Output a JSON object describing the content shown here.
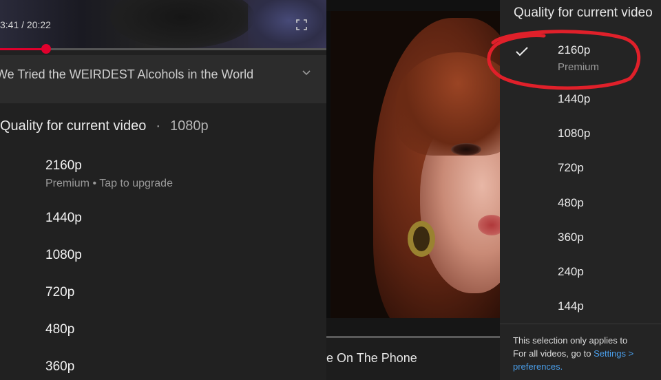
{
  "left_panel": {
    "timecode": "3:41 / 20:22",
    "progress_fraction": 0.15,
    "video_title": "We Tried the WEIRDEST Alcohols in the World",
    "quality_header": {
      "label": "Quality for current video",
      "separator": "·",
      "current": "1080p"
    },
    "options": [
      {
        "label": "2160p",
        "sub": "Premium • Tap to upgrade"
      },
      {
        "label": "1440p"
      },
      {
        "label": "1080p"
      },
      {
        "label": "720p"
      },
      {
        "label": "480p"
      },
      {
        "label": "360p"
      }
    ]
  },
  "center_panel": {
    "caption": "e On The Phone"
  },
  "right_panel": {
    "header": "Quality for current video",
    "selected_index": 0,
    "options": [
      {
        "label": "2160p",
        "sub": "Premium"
      },
      {
        "label": "1440p"
      },
      {
        "label": "1080p"
      },
      {
        "label": "720p"
      },
      {
        "label": "480p"
      },
      {
        "label": "360p"
      },
      {
        "label": "240p"
      },
      {
        "label": "144p"
      }
    ],
    "note_line1": "This selection only applies to",
    "note_line2_prefix": "For all videos, go to ",
    "note_link": "Settings >",
    "note_line3": "preferences."
  },
  "colors": {
    "accent_red": "#e1002d",
    "annotation_red": "#e0202a",
    "link_blue": "#4a9eea"
  },
  "icons": {
    "fullscreen": "fullscreen-icon",
    "expand": "chevron-down-icon",
    "selected": "check-icon"
  }
}
